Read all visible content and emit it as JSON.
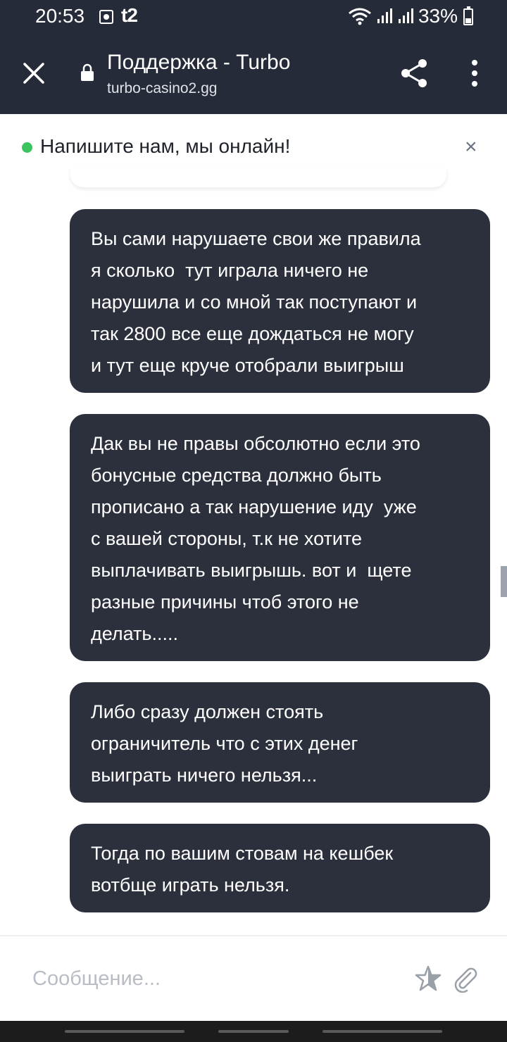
{
  "status_bar": {
    "time": "20:53",
    "carrier": "t2",
    "battery": "33%",
    "icons": [
      "alarm-icon",
      "wifi-icon",
      "signal-icon",
      "signal-icon",
      "battery-icon"
    ]
  },
  "toolbar": {
    "title": "Поддержка - Turbo",
    "url": "turbo-casino2.gg",
    "icons": [
      "close-icon",
      "lock-icon",
      "share-icon",
      "more-vert-icon"
    ]
  },
  "chat_header": {
    "status_text": "Напишите нам, мы онлайн!",
    "status_color": "#3cc55f",
    "close_glyph": "×"
  },
  "messages": [
    {
      "lines": [
        "Вы сами нарушаете свои же правила",
        "я сколько  тут играла ничего не",
        "нарушила и со мной так поступают и",
        "так 2800 все еще дождаться не могу",
        "и тут еще круче отобрали выигрыш"
      ]
    },
    {
      "lines": [
        "Дак вы не правы обсолютно если это",
        "бонусные средства должно быть",
        "прописано а так нарушение иду  уже",
        "с вашей стороны, т.к не хотите",
        "выплачивать выигрышь. вот и  щете",
        "разные причины чтоб этого не",
        "делать....."
      ]
    },
    {
      "lines": [
        "Либо сразу должен стоять",
        "ограничитель что с этих денег",
        "выиграть ничего нельзя..."
      ]
    },
    {
      "lines": [
        "Тогда по вашим стовам на кешбек",
        "вотбще играть нельзя."
      ]
    }
  ],
  "composer": {
    "placeholder": "Сообщение...",
    "icons": [
      "star-icon",
      "paperclip-icon"
    ]
  },
  "colors": {
    "app_bar": "#252b38",
    "bubble": "#2b303c",
    "online": "#3cc55f"
  }
}
